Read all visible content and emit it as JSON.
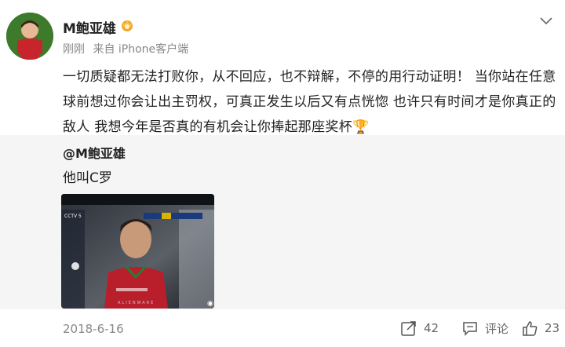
{
  "post": {
    "username": "M鲍亚雄",
    "time": "刚刚",
    "source": "来自 iPhone客户端",
    "text": "一切质疑都无法打败你，从不回应，也不辩解，不停的用行动证明！ 当你站在任意球前想过你会让出主罚权，可真正发生以后又有点恍惚 也许只有时间才是你真正的敌人 我想今年是否真的有机会让你捧起那座奖杯🏆"
  },
  "repost": {
    "author": "@M鲍亚雄",
    "text": "他叫C罗",
    "media": {
      "channel_logo": "CCTV 5",
      "watermark": "ALIENWARE"
    }
  },
  "footer": {
    "date": "2018-6-16",
    "share_count": "42",
    "comment_label": "评论",
    "like_count": "23"
  },
  "icons": {
    "vip": "gold-vip-badge-icon",
    "more": "chevron-down-icon",
    "share": "share-icon",
    "comment": "comment-icon",
    "like": "thumbs-up-icon"
  },
  "colors": {
    "repost_bg": "#f5f5f5",
    "meta_text": "#888888",
    "badge_gold": "#f5a623"
  }
}
